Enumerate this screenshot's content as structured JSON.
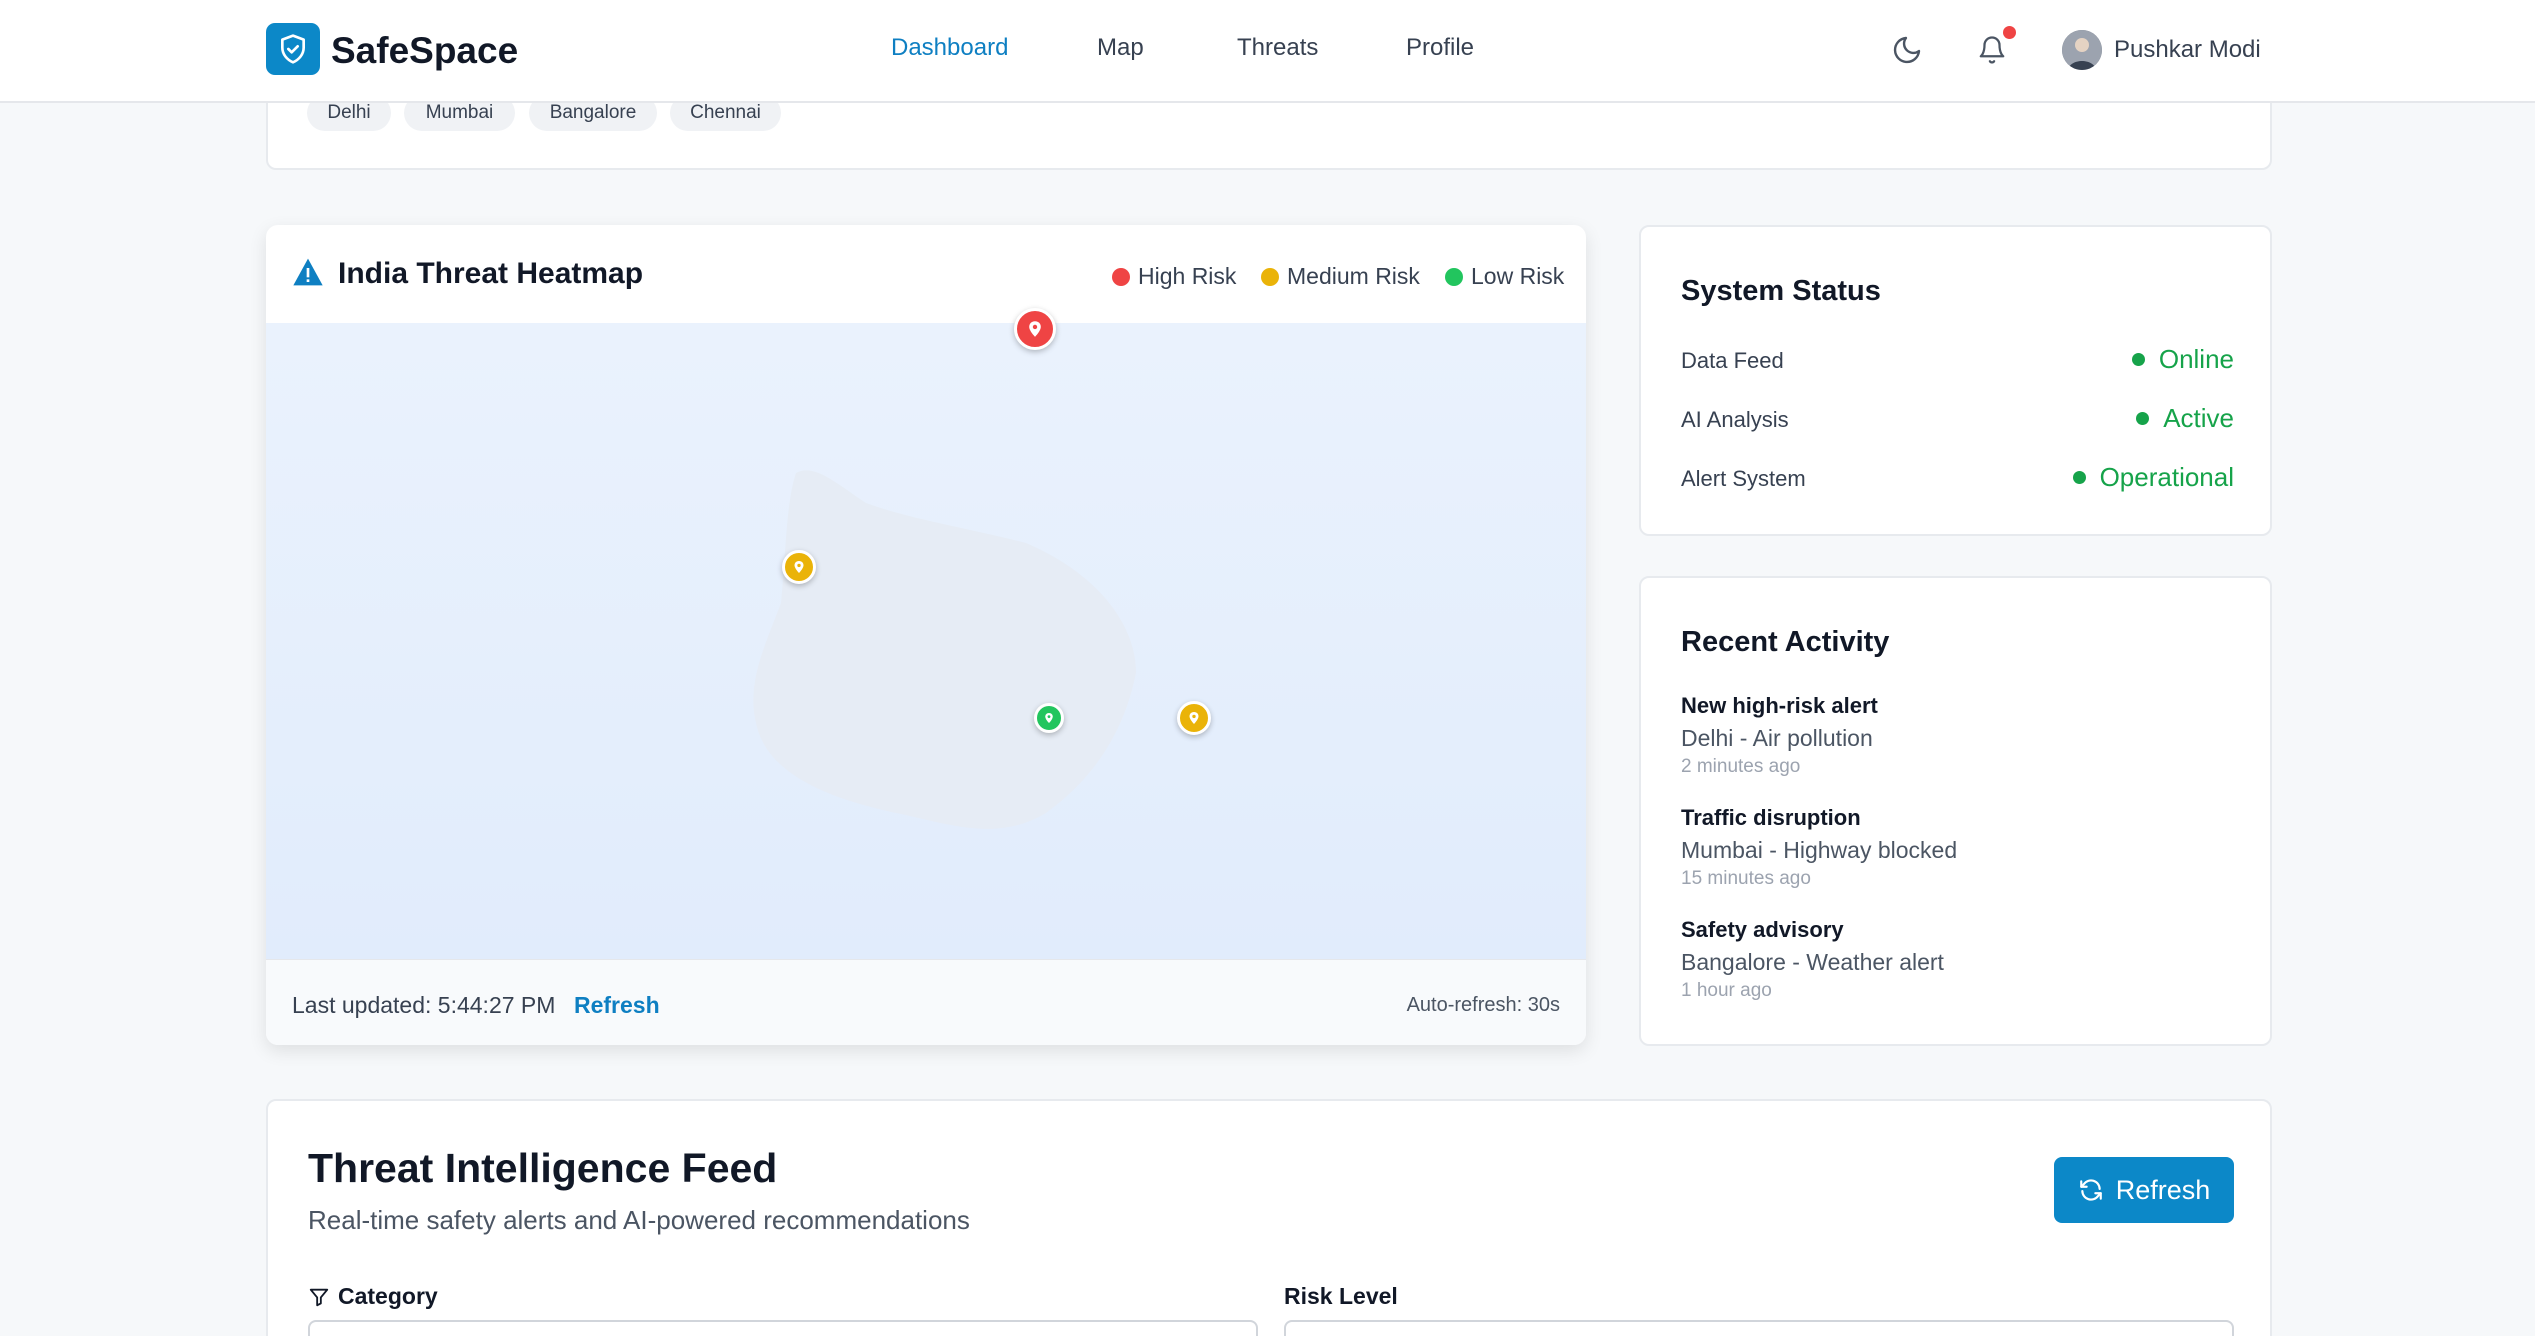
{
  "app": {
    "name": "SafeSpace"
  },
  "nav": {
    "items": [
      {
        "label": "Dashboard",
        "active": true
      },
      {
        "label": "Map"
      },
      {
        "label": "Threats"
      },
      {
        "label": "Profile"
      }
    ]
  },
  "user": {
    "name": "Pushkar Modi"
  },
  "cities": [
    "Delhi",
    "Mumbai",
    "Bangalore",
    "Chennai"
  ],
  "heatmap": {
    "title": "India Threat Heatmap",
    "legend": [
      {
        "label": "High Risk",
        "color": "#ef4444"
      },
      {
        "label": "Medium Risk",
        "color": "#eab308"
      },
      {
        "label": "Low Risk",
        "color": "#22c55e"
      }
    ],
    "last_updated_label": "Last updated: 5:44:27 PM",
    "refresh_label": "Refresh",
    "auto_refresh": "Auto-refresh: 30s"
  },
  "system_status": {
    "title": "System Status",
    "rows": [
      {
        "label": "Data Feed",
        "value": "Online"
      },
      {
        "label": "AI Analysis",
        "value": "Active"
      },
      {
        "label": "Alert System",
        "value": "Operational"
      }
    ]
  },
  "recent_activity": {
    "title": "Recent Activity",
    "items": [
      {
        "title": "New high-risk alert",
        "desc": "Delhi - Air pollution",
        "time": "2 minutes ago"
      },
      {
        "title": "Traffic disruption",
        "desc": "Mumbai - Highway blocked",
        "time": "15 minutes ago"
      },
      {
        "title": "Safety advisory",
        "desc": "Bangalore - Weather alert",
        "time": "1 hour ago"
      }
    ]
  },
  "feed": {
    "title": "Threat Intelligence Feed",
    "subtitle": "Real-time safety alerts and AI-powered recommendations",
    "refresh_label": "Refresh",
    "category_label": "Category",
    "risk_label": "Risk Level"
  }
}
